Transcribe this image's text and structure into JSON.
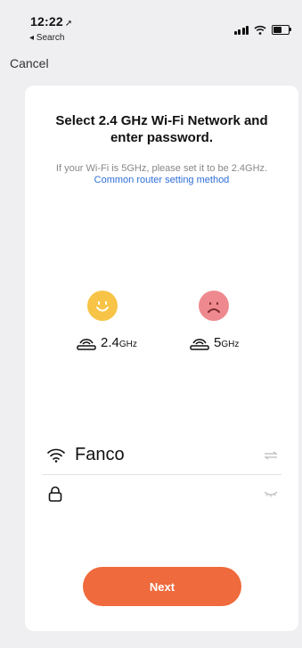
{
  "status_bar": {
    "time": "12:22",
    "back_app": "◂ Search"
  },
  "nav": {
    "cancel_label": "Cancel"
  },
  "card": {
    "title": "Select 2.4 GHz Wi-Fi Network and enter password.",
    "subtitle_text": "If your Wi-Fi is 5GHz, please set it to be 2.4GHz.",
    "subtitle_link": "Common router setting method",
    "bands": [
      {
        "value": "2.4",
        "unit": "GHz",
        "status": "supported"
      },
      {
        "value": "5",
        "unit": "GHz",
        "status": "unsupported"
      }
    ],
    "wifi": {
      "ssid": "Fanco",
      "password_placeholder": ""
    },
    "next_label": "Next"
  },
  "colors": {
    "accent": "#ef6a3c",
    "link": "#2f6fd8",
    "good_face": "#f7c447",
    "bad_face": "#ee8a8f",
    "background": "#efeff1"
  }
}
